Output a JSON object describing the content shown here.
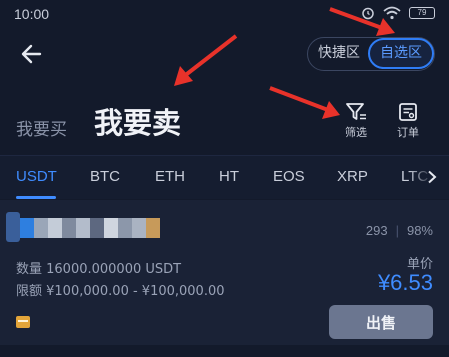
{
  "status_bar": {
    "time": "10:00",
    "battery": "79"
  },
  "header": {
    "segments": [
      {
        "label": "快捷区",
        "active": false
      },
      {
        "label": "自选区",
        "active": true
      }
    ]
  },
  "title_row": {
    "buy_tab": "我要买",
    "sell_tab": "我要卖",
    "filter_label": "筛选",
    "orders_label": "订单"
  },
  "currency_tabs": [
    "USDT",
    "BTC",
    "ETH",
    "HT",
    "EOS",
    "XRP",
    "LTC"
  ],
  "active_currency": "USDT",
  "listing": {
    "trades": "293",
    "completion": "98%",
    "quantity": "数量 16000.000000 USDT",
    "limit": "限额 ¥100,000.00 - ¥100,000.00",
    "price_label": "单价",
    "price": "¥6.53",
    "sell_button": "出售"
  },
  "colors": {
    "background": "#131a2b",
    "accent_blue": "#3f8cff",
    "annotation_red": "#e8322a",
    "button_gray": "#6b7690"
  },
  "icons": [
    "back-arrow-icon",
    "filter-icon",
    "orders-icon",
    "wifi-icon",
    "chevron-right-icon",
    "payment-card-icon"
  ]
}
